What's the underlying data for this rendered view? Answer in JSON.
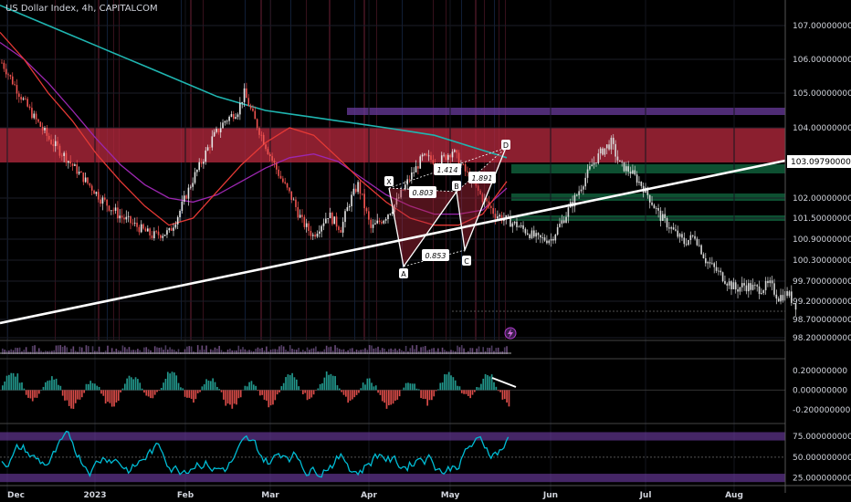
{
  "header": {
    "title": "US Dollar Index, 4h, CAPITALCOM"
  },
  "colors": {
    "background": "#000000",
    "supply_zone": "#b2283c",
    "demand_zone": "#0f5e3a",
    "purple_band": "#6a3b9c",
    "ma_teal": "#1fb5b0",
    "ma_purple": "#9c27b0",
    "ma_red": "#e53935",
    "trendline": "#ffffff",
    "hist_pos": "#26a69a",
    "hist_neg": "#ef5350",
    "rsi_line": "#00bcd4"
  },
  "chart_data": [
    {
      "type": "candlestick",
      "title": "US Dollar Index, 4h, CAPITALCOM",
      "current_price_label": "103.097900000",
      "y_ticks": [
        "107.000000000",
        "106.000000000",
        "105.000000000",
        "104.000000000",
        "102.000000000",
        "101.500000000",
        "100.900000000",
        "100.300000000",
        "99.700000000",
        "99.200000000",
        "98.700000000",
        "98.200000000"
      ],
      "y_tick_values": [
        107.0,
        106.0,
        105.0,
        104.0,
        102.0,
        101.5,
        100.9,
        100.3,
        99.7,
        99.2,
        98.7,
        98.2
      ],
      "x_ticks": [
        "Dec",
        "2023",
        "Feb",
        "Mar",
        "Apr",
        "May",
        "Jun",
        "Jul",
        "Aug"
      ],
      "ylim": [
        98.2,
        107.8
      ],
      "price_path": [
        [
          0,
          105.9
        ],
        [
          8,
          105.0
        ],
        [
          15,
          104.3
        ],
        [
          22,
          103.7
        ],
        [
          30,
          103.2
        ],
        [
          38,
          102.6
        ],
        [
          46,
          102.0
        ],
        [
          54,
          101.6
        ],
        [
          62,
          101.3
        ],
        [
          70,
          101.0
        ],
        [
          78,
          101.1
        ],
        [
          84,
          101.8
        ],
        [
          90,
          102.7
        ],
        [
          98,
          103.7
        ],
        [
          104,
          104.2
        ],
        [
          110,
          104.5
        ],
        [
          113,
          105.0
        ],
        [
          118,
          104.2
        ],
        [
          124,
          103.4
        ],
        [
          130,
          102.6
        ],
        [
          136,
          101.9
        ],
        [
          140,
          101.4
        ],
        [
          145,
          101.0
        ],
        [
          152,
          101.6
        ],
        [
          158,
          101.2
        ],
        [
          162,
          101.9
        ],
        [
          166,
          102.4
        ],
        [
          172,
          101.2
        ],
        [
          178,
          101.5
        ],
        [
          184,
          101.9
        ],
        [
          190,
          102.6
        ],
        [
          196,
          103.2
        ],
        [
          204,
          103.1
        ],
        [
          210,
          103.4
        ],
        [
          218,
          102.6
        ],
        [
          224,
          102.0
        ],
        [
          230,
          101.6
        ],
        [
          240,
          101.3
        ],
        [
          250,
          100.9
        ],
        [
          256,
          100.9
        ],
        [
          262,
          101.5
        ],
        [
          268,
          102.1
        ],
        [
          275,
          103.0
        ],
        [
          280,
          103.4
        ],
        [
          284,
          103.6
        ],
        [
          288,
          103.0
        ],
        [
          293,
          102.8
        ],
        [
          298,
          102.4
        ],
        [
          302,
          102.0
        ],
        [
          306,
          101.6
        ],
        [
          312,
          101.2
        ],
        [
          318,
          100.8
        ],
        [
          323,
          101.0
        ],
        [
          328,
          100.3
        ],
        [
          333,
          100.0
        ],
        [
          338,
          99.7
        ],
        [
          342,
          99.5
        ],
        [
          346,
          99.6
        ],
        [
          352,
          99.5
        ],
        [
          358,
          99.6
        ],
        [
          362,
          99.3
        ],
        [
          366,
          99.4
        ],
        [
          370,
          99.1
        ]
      ],
      "support_zone": [
        101.6,
        101.9
      ],
      "series": [
        {
          "name": "",
          "values": [
            107.6,
            107.3,
            107.0,
            106.7,
            106.4,
            106.1,
            105.8,
            105.5,
            105.2,
            104.9,
            104.7,
            104.5,
            104.4,
            104.3,
            104.2,
            104.1,
            104.0,
            103.9,
            103.8,
            103.6,
            103.4,
            103.2
          ]
        },
        {
          "name": "",
          "values": [
            106.5,
            106.0,
            105.3,
            104.5,
            103.7,
            103.0,
            102.4,
            102.0,
            101.9,
            102.1,
            102.5,
            102.9,
            103.2,
            103.3,
            103.1,
            102.6,
            102.1,
            101.8,
            101.6,
            101.6,
            101.7,
            102.3
          ]
        },
        {
          "name": "",
          "values": [
            106.8,
            106.0,
            105.0,
            104.2,
            103.3,
            102.5,
            101.8,
            101.3,
            101.5,
            102.2,
            103.0,
            103.6,
            104.0,
            103.8,
            103.2,
            102.5,
            101.9,
            101.5,
            101.3,
            101.3,
            101.6,
            102.5
          ]
        }
      ],
      "annotations": [
        {
          "text": "1.414"
        },
        {
          "text": "0.803"
        },
        {
          "text": "1.891"
        },
        {
          "text": "0.853"
        },
        {
          "text": "X"
        },
        {
          "text": "A"
        },
        {
          "text": "B"
        },
        {
          "text": "C"
        },
        {
          "text": "D"
        }
      ]
    },
    {
      "type": "bar",
      "y_ticks": [
        "0.200000000",
        "0.000000000",
        "-0.200000000"
      ],
      "y_tick_values": [
        0.2,
        0.0,
        -0.2
      ],
      "ylim": [
        -0.32,
        0.3
      ]
    },
    {
      "type": "line",
      "y_ticks": [
        "75.000000000",
        "50.000000000",
        "25.000000000"
      ],
      "y_tick_values": [
        75,
        50,
        25
      ],
      "ylim": [
        18,
        86
      ],
      "bands": [
        [
          70,
          80
        ],
        [
          20,
          30
        ]
      ]
    }
  ]
}
